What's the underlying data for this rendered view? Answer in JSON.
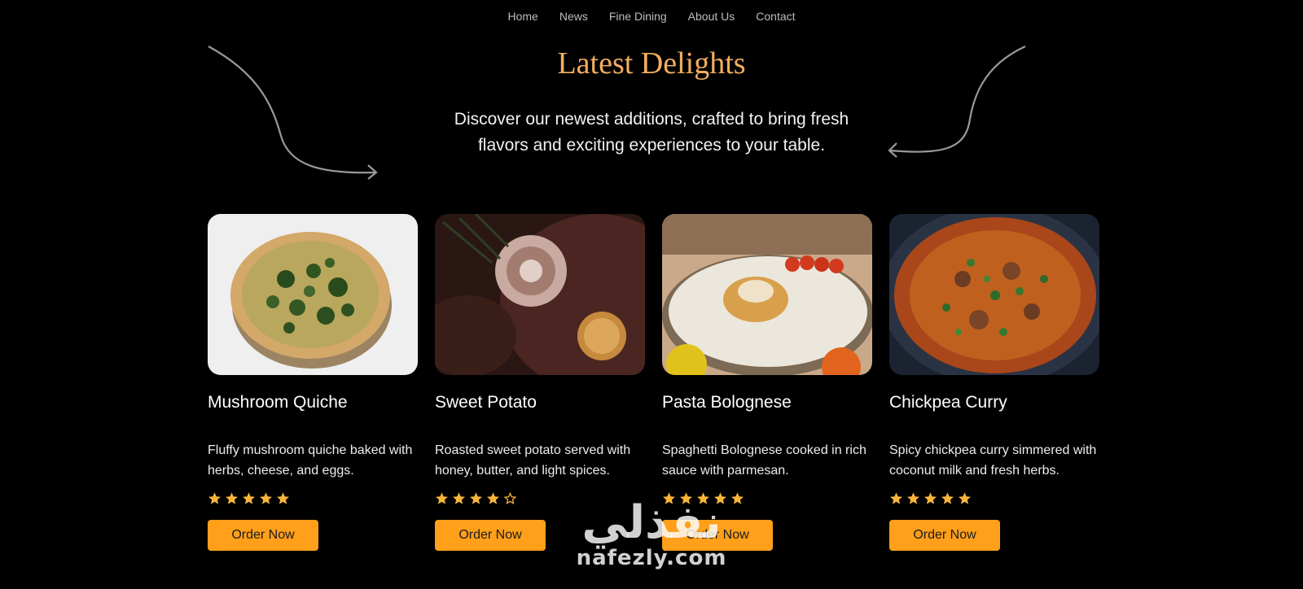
{
  "nav": {
    "items": [
      "Home",
      "News",
      "Fine Dining",
      "About Us",
      "Contact"
    ]
  },
  "hero": {
    "title": "Latest Delights",
    "subtitle": "Discover our newest additions, crafted to bring fresh flavors and exciting experiences to your table."
  },
  "colors": {
    "background": "#000000",
    "title": "#f2ae5f",
    "button": "#ff9f1a",
    "star": "#f8b53a"
  },
  "dishes": [
    {
      "name": "Mushroom Quiche",
      "description": "Fluffy mushroom quiche baked with herbs, cheese, and eggs.",
      "rating": 5,
      "button": "Order Now"
    },
    {
      "name": "Sweet Potato",
      "description": "Roasted sweet potato served with honey, butter, and light spices.",
      "rating": 4,
      "button": "Order Now"
    },
    {
      "name": "Pasta Bolognese",
      "description": "Spaghetti Bolognese cooked in rich sauce with parmesan.",
      "rating": 5,
      "button": "Order Now"
    },
    {
      "name": "Chickpea Curry",
      "description": "Spicy chickpea curry simmered with coconut milk and fresh herbs.",
      "rating": 5,
      "button": "Order Now"
    }
  ],
  "watermark": {
    "arabic": "نفذلي",
    "latin": "nafezly.com"
  }
}
